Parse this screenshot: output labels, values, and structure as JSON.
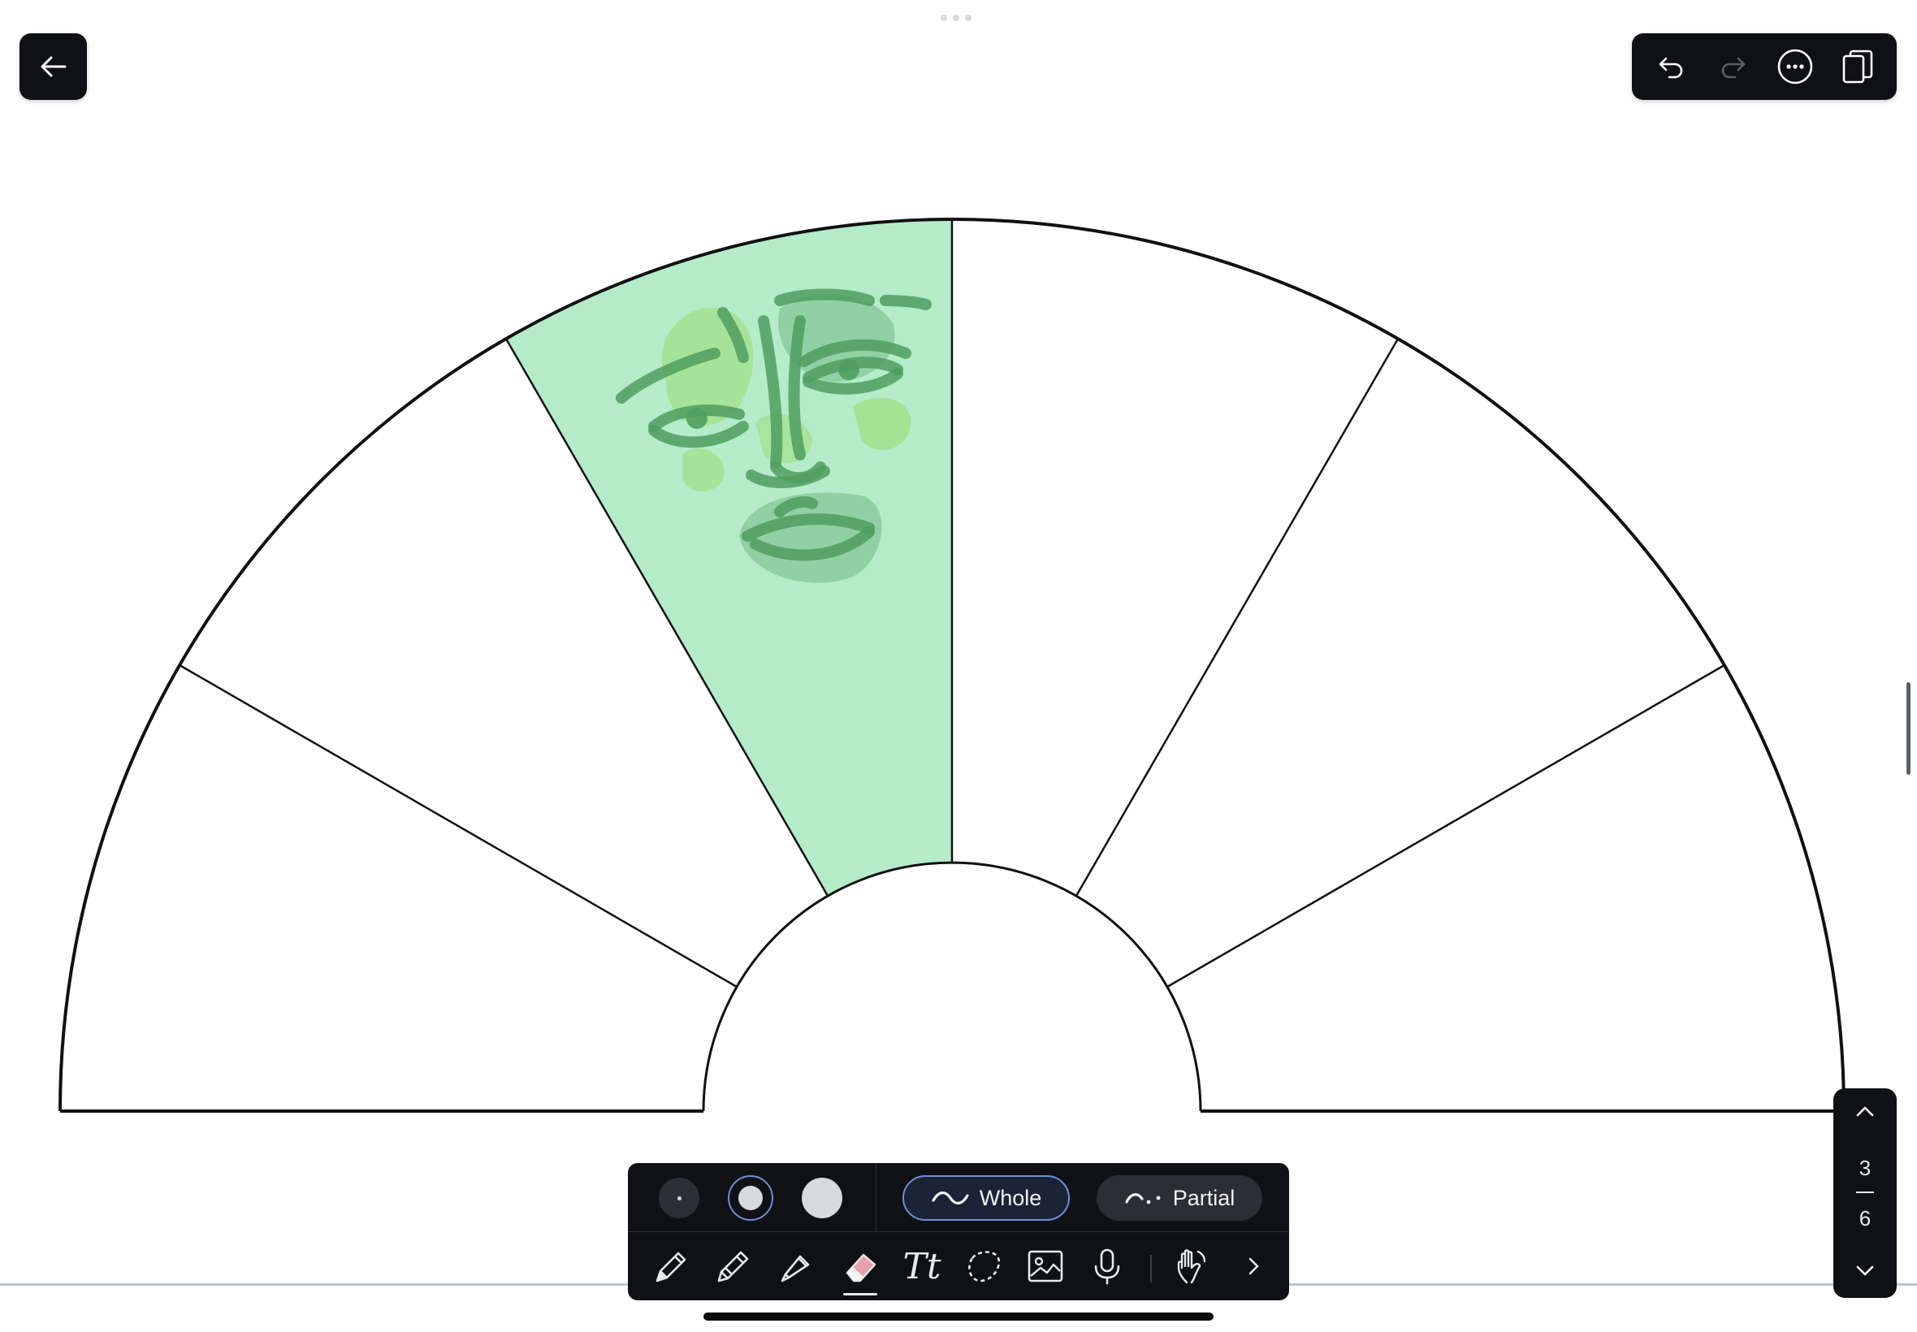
{
  "topbar": {
    "back_icon": "arrow-left-icon",
    "actions": [
      {
        "name": "undo",
        "icon": "undo-icon"
      },
      {
        "name": "redo",
        "icon": "redo-icon"
      },
      {
        "name": "more",
        "icon": "more-icon"
      },
      {
        "name": "pages",
        "icon": "pages-icon"
      }
    ]
  },
  "canvas": {
    "segments": 6,
    "highlighted_segment": 2,
    "highlight_color": "#b4ecca",
    "sketch_color": "#4f9e5f",
    "sketch_light_color": "#9bdc70"
  },
  "eraser_toolbar": {
    "sizes": [
      "small",
      "medium",
      "large"
    ],
    "selected_size": "medium",
    "modes": [
      {
        "id": "whole",
        "label": "Whole",
        "icon": "wave-icon",
        "selected": true
      },
      {
        "id": "partial",
        "label": "Partial",
        "icon": "dotted-wave-icon",
        "selected": false
      }
    ],
    "tools": [
      {
        "id": "pen",
        "icon": "pen-icon"
      },
      {
        "id": "pencil",
        "icon": "pencil-icon"
      },
      {
        "id": "highlighter",
        "icon": "highlighter-icon"
      },
      {
        "id": "eraser",
        "icon": "eraser-icon",
        "active": true
      },
      {
        "id": "text",
        "label": "Tt",
        "icon": "text-icon"
      },
      {
        "id": "lasso",
        "icon": "lasso-icon"
      },
      {
        "id": "image",
        "icon": "image-icon"
      },
      {
        "id": "audio",
        "icon": "microphone-icon"
      },
      {
        "id": "touch",
        "icon": "hand-icon"
      },
      {
        "id": "expand",
        "icon": "chevron-right-icon"
      }
    ]
  },
  "page_nav": {
    "current_page": "3",
    "total_pages": "6"
  },
  "colors": {
    "toolbar_bg": "#101114",
    "accent": "#6e8fd8",
    "eraser_tip": "#e8a0a8"
  }
}
